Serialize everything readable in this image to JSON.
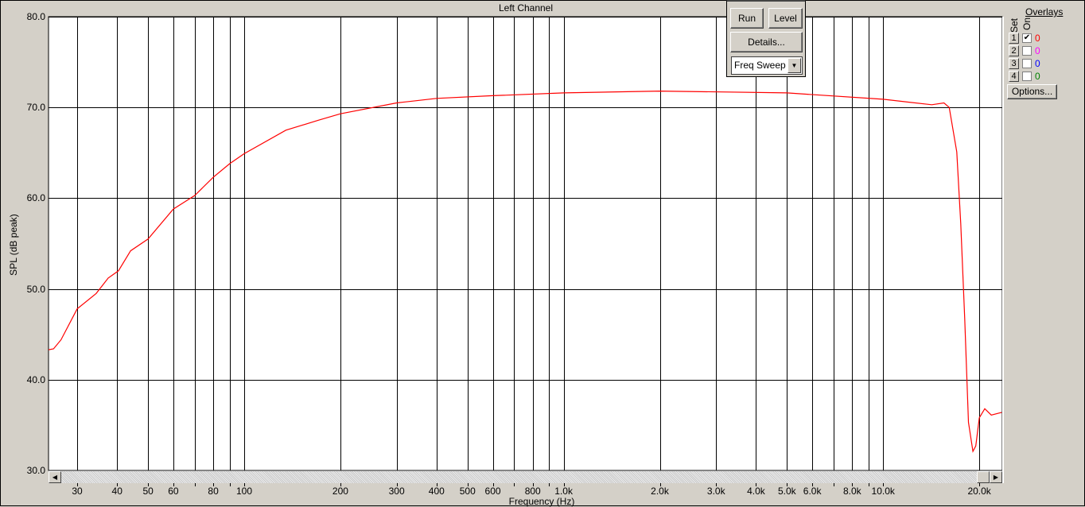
{
  "title": "Left Channel",
  "controls": {
    "run": "Run",
    "level": "Level",
    "details": "Details...",
    "mode": "Freq Sweep"
  },
  "overlays": {
    "title": "Overlays",
    "set_label": "Set",
    "on_label": "On",
    "options": "Options...",
    "rows": [
      {
        "set": "1",
        "on": true,
        "count": "0",
        "color": "#ff0000"
      },
      {
        "set": "2",
        "on": false,
        "count": "0",
        "color": "#ff00ff"
      },
      {
        "set": "3",
        "on": false,
        "count": "0",
        "color": "#0000ff"
      },
      {
        "set": "4",
        "on": false,
        "count": "0",
        "color": "#008000"
      }
    ]
  },
  "chart_data": {
    "type": "line",
    "title": "Left Channel",
    "xlabel": "Frequency (Hz)",
    "ylabel": "SPL (dB peak)",
    "xscale": "log",
    "xlim": [
      24.4,
      23600
    ],
    "ylim": [
      30,
      80
    ],
    "grid": true,
    "yticks": [
      30,
      40,
      50,
      60,
      70,
      80
    ],
    "ytick_labels": [
      "30.0",
      "40.0",
      "50.0",
      "60.0",
      "70.0",
      "80.0"
    ],
    "xgrid": [
      30,
      40,
      50,
      60,
      70,
      80,
      90,
      100,
      200,
      300,
      400,
      500,
      600,
      700,
      800,
      900,
      1000,
      2000,
      3000,
      4000,
      5000,
      6000,
      7000,
      8000,
      9000,
      10000,
      20000
    ],
    "xticks": [
      30,
      40,
      50,
      60,
      80,
      100,
      200,
      300,
      400,
      500,
      600,
      800,
      1000,
      2000,
      3000,
      4000,
      5000,
      6000,
      8000,
      10000,
      20000
    ],
    "xtick_labels": [
      "30",
      "40",
      "50",
      "60",
      "80",
      "100",
      "200",
      "300",
      "400",
      "500",
      "600",
      "800",
      "1.0k",
      "2.0k",
      "3.0k",
      "4.0k",
      "5.0k",
      "6.0k",
      "8.0k",
      "10.0k",
      "20.0k"
    ],
    "series": [
      {
        "color": "#ff0000",
        "points": [
          [
            24.4,
            43.3
          ],
          [
            25.3,
            43.4
          ],
          [
            26.7,
            44.4
          ],
          [
            30,
            47.8
          ],
          [
            34.4,
            49.5
          ],
          [
            37.5,
            51.2
          ],
          [
            40.4,
            52.0
          ],
          [
            44.1,
            54.2
          ],
          [
            50,
            55.5
          ],
          [
            60,
            58.8
          ],
          [
            70,
            60.3
          ],
          [
            80,
            62.3
          ],
          [
            90,
            63.8
          ],
          [
            100,
            64.9
          ],
          [
            135,
            67.5
          ],
          [
            171,
            68.6
          ],
          [
            200,
            69.3
          ],
          [
            300,
            70.5
          ],
          [
            400,
            71.0
          ],
          [
            600,
            71.3
          ],
          [
            1000,
            71.6
          ],
          [
            2000,
            71.8
          ],
          [
            5000,
            71.6
          ],
          [
            10000,
            70.9
          ],
          [
            14200,
            70.3
          ],
          [
            15500,
            70.5
          ],
          [
            16100,
            70.0
          ],
          [
            17000,
            65.1
          ],
          [
            17500,
            57.2
          ],
          [
            18000,
            46.7
          ],
          [
            18500,
            35.3
          ],
          [
            19100,
            32.1
          ],
          [
            19500,
            32.7
          ],
          [
            20000,
            35.8
          ],
          [
            20800,
            36.8
          ],
          [
            21800,
            36.1
          ],
          [
            23500,
            36.4
          ]
        ]
      }
    ]
  }
}
